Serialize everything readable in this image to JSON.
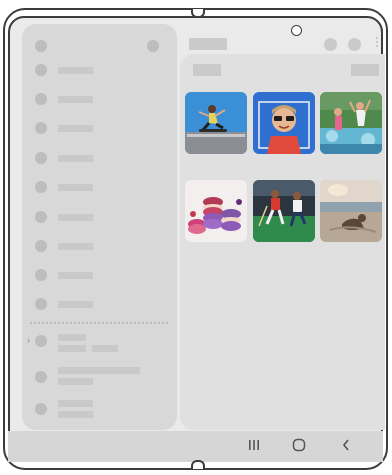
{
  "device": {
    "type": "foldable-phone"
  },
  "sidebar": {
    "items": 11,
    "has_expandable_item": true
  },
  "gallery": {
    "header_left": "",
    "header_right": "",
    "photos": [
      {
        "subject": "skateboarder-jumping"
      },
      {
        "subject": "child-with-sunglasses"
      },
      {
        "subject": "kids-splashing-water"
      },
      {
        "subject": "stacked-macarons"
      },
      {
        "subject": "field-hockey-players"
      },
      {
        "subject": "dog-on-beach"
      }
    ]
  },
  "navbar": {
    "recents_icon": "recents-icon",
    "home_icon": "home-icon",
    "back_icon": "back-icon"
  },
  "colors": {
    "placeholder": "#cacaca",
    "panel": "#d8d8d8",
    "background": "#eaeaea"
  }
}
